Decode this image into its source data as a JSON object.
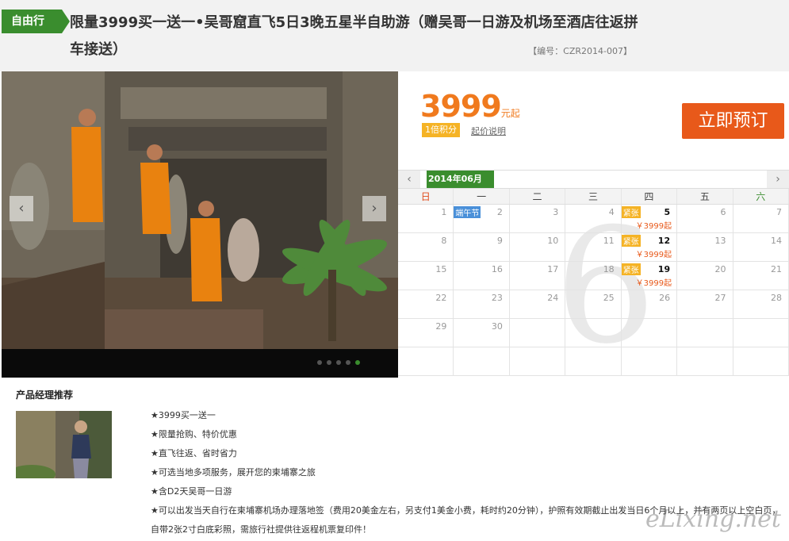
{
  "header": {
    "tag": "自由行",
    "title": "限量3999买一送一•吴哥窟直飞5日3晚五星半自助游（赠吴哥一日游及机场至酒店往返拼车接送）",
    "code": "【编号：CZR2014-007】"
  },
  "price": {
    "value": "3999",
    "unit": "元起",
    "points": "1倍积分",
    "explain": "起价说明",
    "book": "立即预订"
  },
  "calendar": {
    "month": "2014年06月",
    "bg_number": "6",
    "weekdays": [
      "日",
      "一",
      "二",
      "三",
      "四",
      "五",
      "六"
    ],
    "holiday": "端午节",
    "tight": "紧张",
    "price": "￥3999起",
    "weeks": [
      [
        {
          "d": "1"
        },
        {
          "d": "2",
          "holiday": true
        },
        {
          "d": "3"
        },
        {
          "d": "4"
        },
        {
          "d": "5",
          "hot": true
        },
        {
          "d": "6"
        },
        {
          "d": "7"
        }
      ],
      [
        {
          "d": "8"
        },
        {
          "d": "9"
        },
        {
          "d": "10"
        },
        {
          "d": "11"
        },
        {
          "d": "12",
          "hot": true
        },
        {
          "d": "13"
        },
        {
          "d": "14"
        }
      ],
      [
        {
          "d": "15"
        },
        {
          "d": "16"
        },
        {
          "d": "17"
        },
        {
          "d": "18"
        },
        {
          "d": "19",
          "hot": true
        },
        {
          "d": "20"
        },
        {
          "d": "21"
        }
      ],
      [
        {
          "d": "22"
        },
        {
          "d": "23"
        },
        {
          "d": "24"
        },
        {
          "d": "25"
        },
        {
          "d": "26"
        },
        {
          "d": "27"
        },
        {
          "d": "28"
        }
      ],
      [
        {
          "d": "29"
        },
        {
          "d": "30"
        },
        {
          "d": ""
        },
        {
          "d": ""
        },
        {
          "d": ""
        },
        {
          "d": ""
        },
        {
          "d": ""
        }
      ],
      [
        {
          "d": ""
        },
        {
          "d": ""
        },
        {
          "d": ""
        },
        {
          "d": ""
        },
        {
          "d": ""
        },
        {
          "d": ""
        },
        {
          "d": ""
        }
      ]
    ]
  },
  "slider": {
    "prev_icon": "‹",
    "next_icon": "›",
    "dots": 5,
    "active_dot": 4
  },
  "recommend": {
    "title": "产品经理推荐",
    "items": [
      "★3999买一送一",
      "★限量抢购、特价优惠",
      "★直飞往返、省时省力",
      "★可选当地多项服务，展开您的柬埔寨之旅",
      "★含D2天吴哥一日游",
      "★可以出发当天自行在柬埔寨机场办理落地签（费用20美金左右，另支付1美金小费，耗时约20分钟），护照有效期截止出发当日6个月以上，并有两页以上空白页，自带2张2寸白底彩照，需旅行社提供往返程机票复印件！"
    ]
  },
  "watermark": "eLixing.net",
  "colors": {
    "green": "#3a8d2e",
    "orange": "#f07a1e",
    "button": "#e8591a"
  }
}
